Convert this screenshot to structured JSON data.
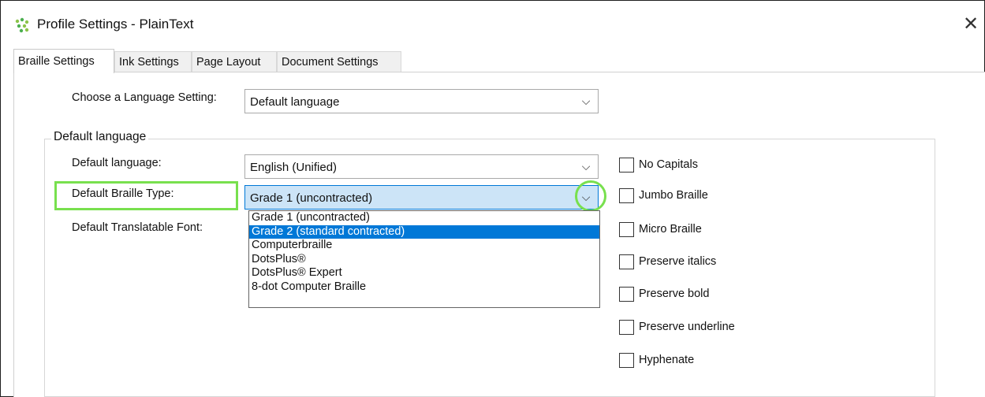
{
  "window": {
    "title": "Profile Settings - PlainText",
    "close_glyph": "✕"
  },
  "tabs": [
    {
      "label": "Braille Settings",
      "active": true
    },
    {
      "label": "Ink Settings",
      "active": false
    },
    {
      "label": "Page Layout",
      "active": false
    },
    {
      "label": "Document Settings",
      "active": false
    }
  ],
  "language_setting": {
    "label": "Choose a Language Setting:",
    "value": "Default language"
  },
  "group": {
    "title": "Default language",
    "default_language": {
      "label": "Default language:",
      "value": "English (Unified)"
    },
    "braille_type": {
      "label": "Default Braille Type:",
      "value": "Grade 1 (uncontracted)"
    },
    "translatable_font": {
      "label": "Default Translatable Font:"
    }
  },
  "dropdown": {
    "options": [
      "Grade 1 (uncontracted)",
      "Grade 2 (standard contracted)",
      "Computerbraille",
      "DotsPlus®",
      "DotsPlus® Expert",
      "8-dot Computer Braille"
    ],
    "highlighted_index": 1
  },
  "checkboxes": [
    {
      "label": "No Capitals",
      "checked": false
    },
    {
      "label": "Jumbo Braille",
      "checked": false
    },
    {
      "label": "Micro Braille",
      "checked": false
    },
    {
      "label": "Preserve italics",
      "checked": false
    },
    {
      "label": "Preserve bold",
      "checked": false
    },
    {
      "label": "Preserve underline",
      "checked": false
    },
    {
      "label": "Hyphenate",
      "checked": false
    }
  ],
  "icons": {
    "app": "app-logo-icon",
    "chevron": "chevron-down-icon"
  },
  "colors": {
    "annotation_highlight": "#78e04e",
    "selection": "#0078d7",
    "focused_combo": "#cce4f7"
  }
}
